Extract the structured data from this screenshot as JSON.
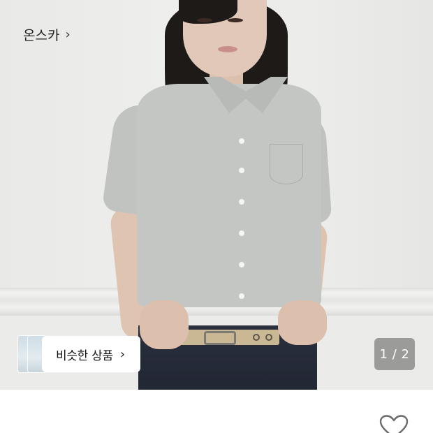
{
  "product_image": {
    "alt": "",
    "colors": {
      "shirt": "#c3c6c3",
      "wall": "#ececea",
      "jeans": "#262b38"
    }
  },
  "similar_items": {
    "label": "비슷한 상품",
    "chevron_icon": "chevron-right-icon"
  },
  "image_counter": {
    "text": "1 / 2"
  },
  "brand": {
    "name": "온스카",
    "chevron_icon": "chevron-right-icon"
  },
  "wishlist": {
    "icon": "heart-outline-icon"
  }
}
